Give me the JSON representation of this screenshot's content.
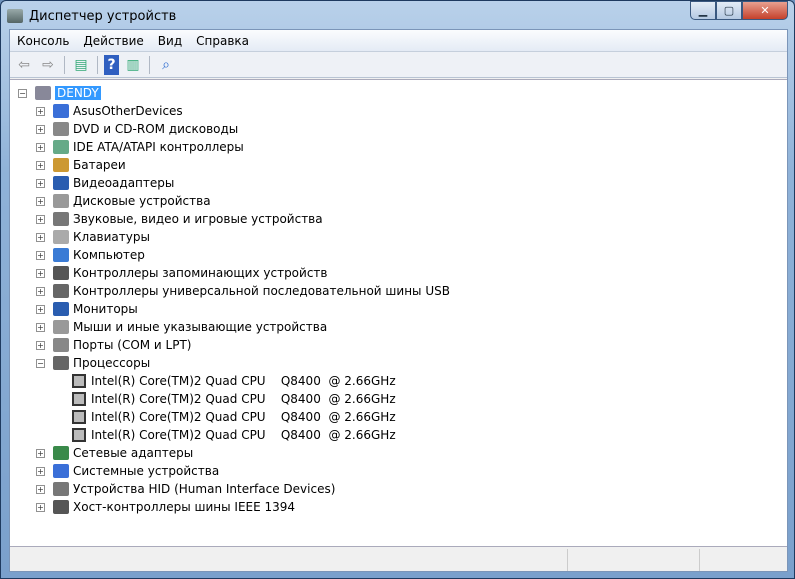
{
  "window": {
    "title": "Диспетчер устройств",
    "minimize": "▁",
    "maximize": "▢",
    "close": "✕"
  },
  "menu": [
    "Консоль",
    "Действие",
    "Вид",
    "Справка"
  ],
  "toolbar": {
    "back": "⇦",
    "forward": "⇨",
    "console_tree": "▤",
    "help": "?",
    "action_pane": "▥",
    "scan": "⌕"
  },
  "tree": {
    "root": "DENDY",
    "expand": "+",
    "collapse": "−",
    "items": [
      {
        "label": "AsusOtherDevices",
        "color": "#3a6fd8"
      },
      {
        "label": "DVD и CD-ROM дисководы",
        "color": "#888"
      },
      {
        "label": "IDE ATA/ATAPI контроллеры",
        "color": "#6a8"
      },
      {
        "label": "Батареи",
        "color": "#c93"
      },
      {
        "label": "Видеоадаптеры",
        "color": "#2a5db0"
      },
      {
        "label": "Дисковые устройства",
        "color": "#999"
      },
      {
        "label": "Звуковые, видео и игровые устройства",
        "color": "#777"
      },
      {
        "label": "Клавиатуры",
        "color": "#aaa"
      },
      {
        "label": "Компьютер",
        "color": "#3a7bd5"
      },
      {
        "label": "Контроллеры запоминающих устройств",
        "color": "#555"
      },
      {
        "label": "Контроллеры универсальной последовательной шины USB",
        "color": "#666"
      },
      {
        "label": "Мониторы",
        "color": "#2a5db0"
      },
      {
        "label": "Мыши и иные указывающие устройства",
        "color": "#999"
      },
      {
        "label": "Порты (COM и LPT)",
        "color": "#888"
      },
      {
        "label": "Процессоры",
        "color": "#666",
        "expanded": true,
        "children": [
          "Intel(R) Core(TM)2 Quad CPU    Q8400  @ 2.66GHz",
          "Intel(R) Core(TM)2 Quad CPU    Q8400  @ 2.66GHz",
          "Intel(R) Core(TM)2 Quad CPU    Q8400  @ 2.66GHz",
          "Intel(R) Core(TM)2 Quad CPU    Q8400  @ 2.66GHz"
        ]
      },
      {
        "label": "Сетевые адаптеры",
        "color": "#3a8a4a"
      },
      {
        "label": "Системные устройства",
        "color": "#3a6fd8"
      },
      {
        "label": "Устройства HID (Human Interface Devices)",
        "color": "#777"
      },
      {
        "label": "Хост-контроллеры шины IEEE 1394",
        "color": "#555"
      }
    ]
  }
}
